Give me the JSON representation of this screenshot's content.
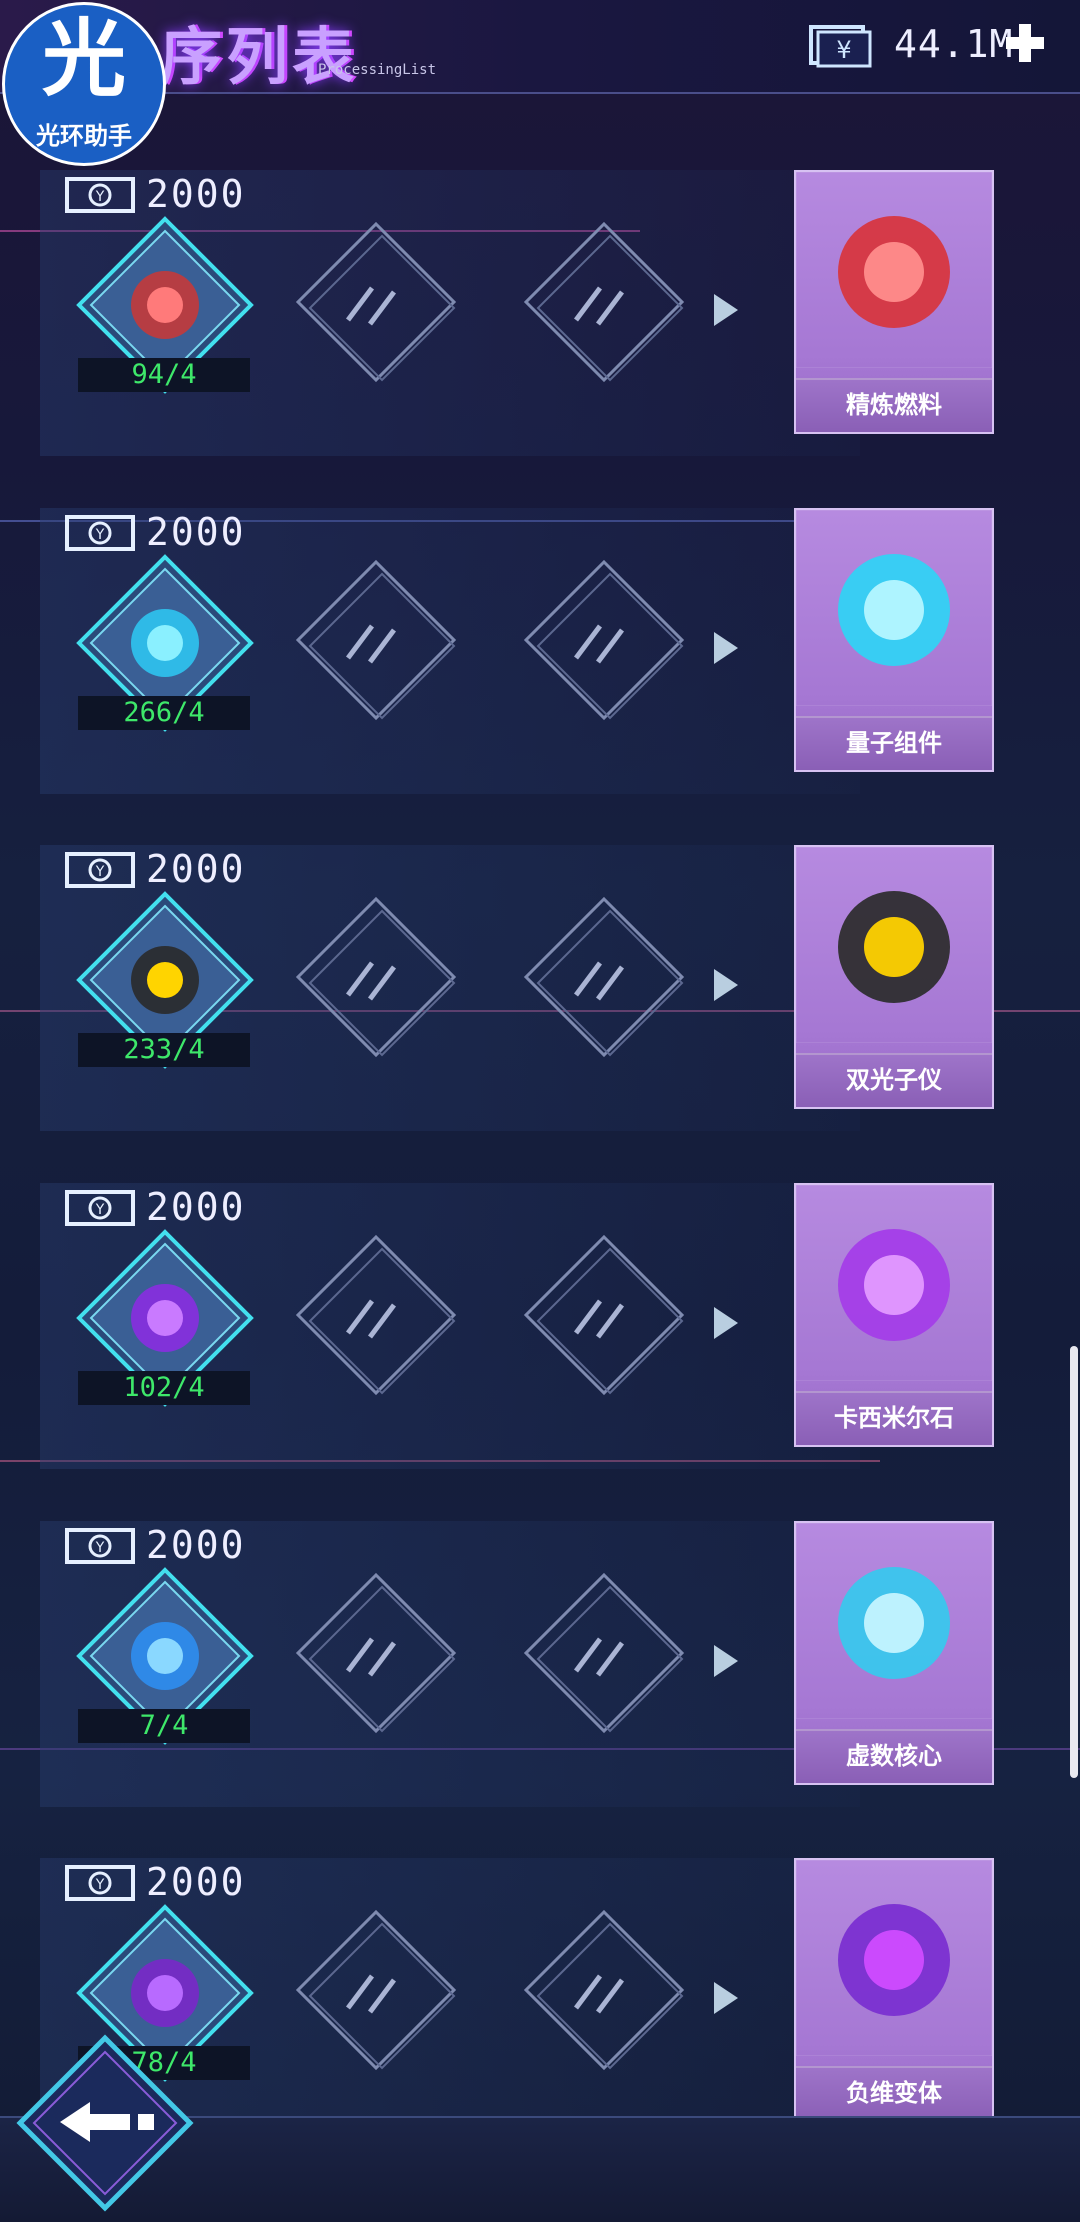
{
  "header": {
    "title": "序列表",
    "subtitle": "ProcessingList",
    "currency": "44.1M",
    "money_icon": "yen-banknote-icon",
    "plus_icon": "plus-icon"
  },
  "logo": {
    "char": "光",
    "text": "光环助手"
  },
  "recipes": [
    {
      "cost": "2000",
      "count": "94/4",
      "material_icon": "fuel-capsule-icon",
      "product": "精炼燃料",
      "product_icon": "refined-fuel-capsule-icon"
    },
    {
      "cost": "2000",
      "count": "266/4",
      "material_icon": "blue-hexagon-crystal-icon",
      "product": "量子组件",
      "product_icon": "quantum-hexagon-cluster-icon"
    },
    {
      "cost": "2000",
      "count": "233/4",
      "material_icon": "gold-pyramid-icon",
      "product": "双光子仪",
      "product_icon": "dual-photon-pyramid-icon"
    },
    {
      "cost": "2000",
      "count": "102/4",
      "material_icon": "purple-cube-crystal-icon",
      "product": "卡西米尔石",
      "product_icon": "casimir-crystal-cubes-icon"
    },
    {
      "cost": "2000",
      "count": "7/4",
      "material_icon": "blue-glass-cube-icon",
      "product": "虚数核心",
      "product_icon": "imaginary-core-icon"
    },
    {
      "cost": "2000",
      "count": "78/4",
      "material_icon": "violet-gem-icon",
      "product": "负维变体",
      "product_icon": "negative-dimension-gem-icon"
    }
  ],
  "footer": {
    "back_icon": "back-arrow-icon"
  },
  "colors": {
    "accent_cyan": "#37d4e6",
    "count_green": "#3ee86a",
    "product_purple": "#a678d4"
  }
}
